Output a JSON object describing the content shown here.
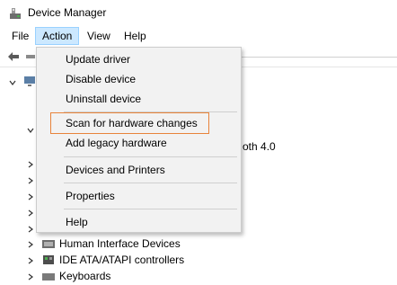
{
  "window": {
    "title": "Device Manager",
    "icon": "device-manager-icon"
  },
  "menubar": {
    "file": "File",
    "action": "Action",
    "view": "View",
    "help": "Help"
  },
  "action_menu": {
    "items": [
      "Update driver",
      "Disable device",
      "Uninstall device",
      "Scan for hardware changes",
      "Add legacy hardware",
      "Devices and Printers",
      "Properties",
      "Help"
    ],
    "highlighted": "Scan for hardware changes",
    "highlight_color": "#e8833a"
  },
  "tree": {
    "partial_bluetooth_text": "oth 4.0",
    "items": [
      "Human Interface Devices",
      "IDE ATA/ATAPI controllers",
      "Keyboards"
    ]
  },
  "colors": {
    "menu_open_bg": "#cce8ff",
    "menu_bg": "#f2f2f2"
  }
}
